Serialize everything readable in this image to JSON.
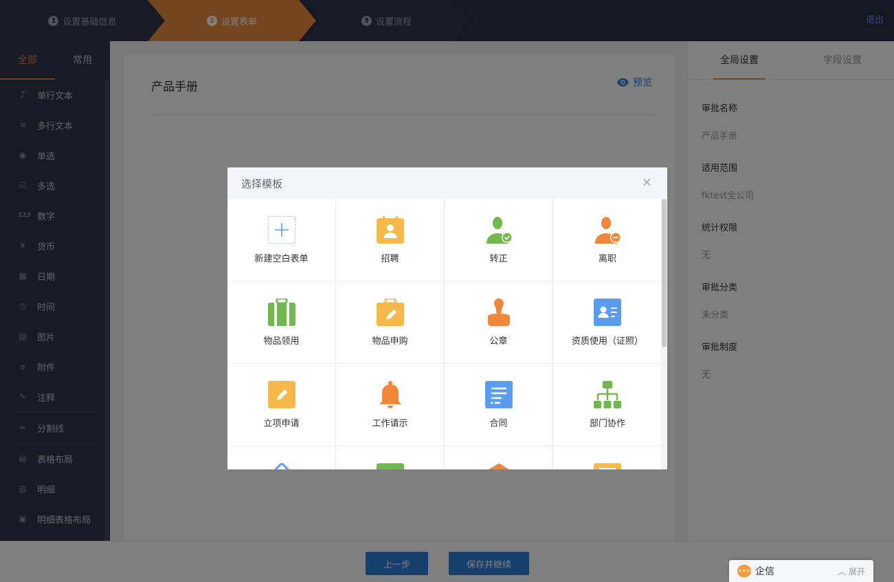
{
  "steps": [
    {
      "num": "1",
      "label": "设置基础信息"
    },
    {
      "num": "2",
      "label": "设置表单"
    },
    {
      "num": "3",
      "label": "设置流程"
    }
  ],
  "exit_label": "退出",
  "left_tabs": [
    "全部",
    "常用"
  ],
  "fields": [
    {
      "icon": "T",
      "label": "单行文本"
    },
    {
      "icon": "≡",
      "label": "多行文本"
    },
    {
      "icon": "◉",
      "label": "单选"
    },
    {
      "icon": "☑",
      "label": "多选"
    },
    {
      "icon": "123",
      "label": "数字"
    },
    {
      "icon": "¥",
      "label": "货币"
    },
    {
      "icon": "▦",
      "label": "日期"
    },
    {
      "icon": "◷",
      "label": "时间"
    },
    {
      "icon": "▨",
      "label": "图片"
    },
    {
      "icon": "⌀",
      "label": "附件"
    },
    {
      "icon": "✎",
      "label": "注释"
    },
    {
      "icon": "═",
      "label": "分割线"
    },
    {
      "icon": "▤",
      "label": "表格布局"
    },
    {
      "icon": "▥",
      "label": "明细"
    },
    {
      "icon": "▣",
      "label": "明细表格布局"
    }
  ],
  "form_title": "产品手册",
  "preview_label": "预览",
  "right_tabs": [
    "全局设置",
    "字段设置"
  ],
  "settings": [
    {
      "label": "审批名称",
      "value": "产品手册"
    },
    {
      "label": "适用范围",
      "value": "fktest全公司"
    },
    {
      "label": "统计权限",
      "value": "无"
    },
    {
      "label": "审批分类",
      "value": "未分类"
    },
    {
      "label": "审批制度",
      "value": "无"
    }
  ],
  "buttons": {
    "prev": "上一步",
    "save": "保存并继续"
  },
  "chat": {
    "title": "企信",
    "expand": "展开"
  },
  "modal": {
    "title": "选择模板",
    "templates": [
      {
        "name": "新建空白表单",
        "icon": "plus-icon"
      },
      {
        "name": "招聘",
        "icon": "recruit-icon"
      },
      {
        "name": "转正",
        "icon": "user-check-icon"
      },
      {
        "name": "离职",
        "icon": "user-minus-icon"
      },
      {
        "name": "物品领用",
        "icon": "bag-icon"
      },
      {
        "name": "物品申购",
        "icon": "purchase-icon"
      },
      {
        "name": "公章",
        "icon": "stamp-icon"
      },
      {
        "name": "资质使用（证照）",
        "icon": "id-card-icon"
      },
      {
        "name": "立项申请",
        "icon": "edit-icon"
      },
      {
        "name": "工作请示",
        "icon": "bell-icon"
      },
      {
        "name": "合同",
        "icon": "contract-icon"
      },
      {
        "name": "部门协作",
        "icon": "org-icon"
      }
    ]
  },
  "colors": {
    "accent": "#e88a3c",
    "primary": "#2e7fd9",
    "sidebar": "#30354d",
    "green": "#72b84e",
    "orange": "#f2863a",
    "yellow": "#f7b84b",
    "blue": "#5a9df0"
  }
}
